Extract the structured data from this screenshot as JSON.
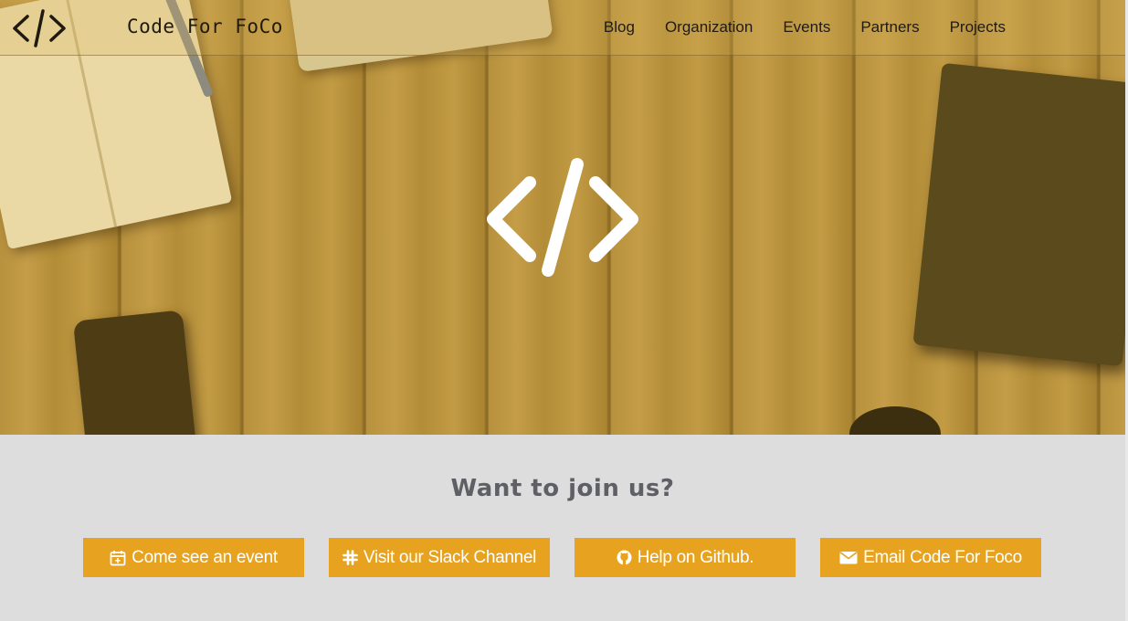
{
  "nav": {
    "brand": "Code For FoCo",
    "logo_icon": "code-brackets-icon",
    "links": [
      "Blog",
      "Organization",
      "Events",
      "Partners",
      "Projects"
    ]
  },
  "hero": {
    "logo_icon": "code-brackets-icon"
  },
  "join": {
    "title": "Want to join us?",
    "buttons": [
      {
        "label": "Come see an event",
        "icon": "calendar-plus-icon"
      },
      {
        "label": "Visit our Slack Channel",
        "icon": "slack-icon"
      },
      {
        "label": "Help on Github.",
        "icon": "github-icon"
      },
      {
        "label": "Email Code For Foco",
        "icon": "envelope-icon"
      }
    ]
  },
  "colors": {
    "accent": "#e7a31f",
    "section_bg": "#dddddd",
    "title_text": "#5f5f66",
    "button_text": "#ffffff"
  }
}
